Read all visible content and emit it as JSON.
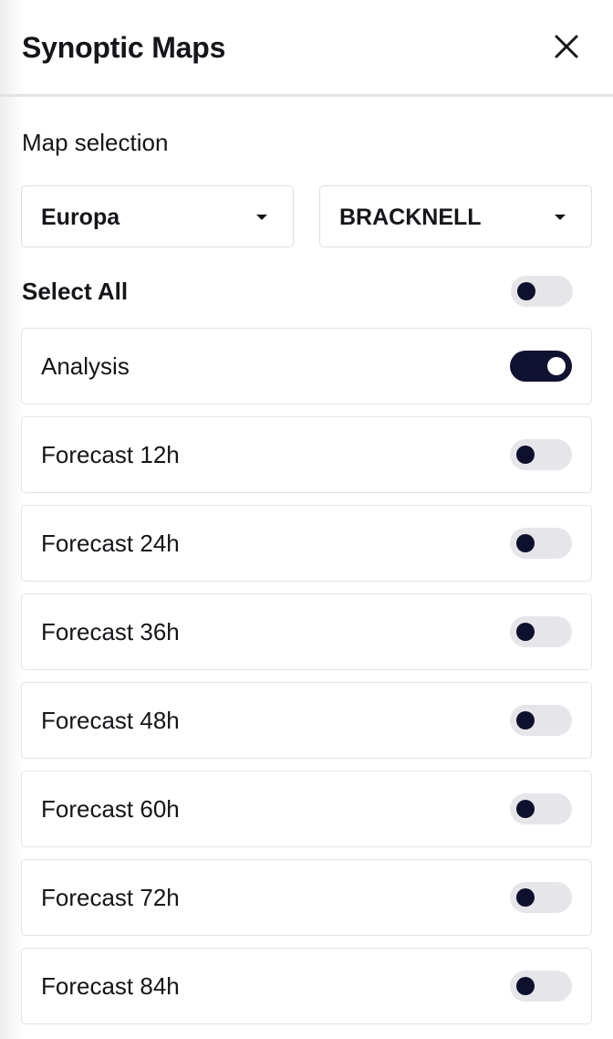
{
  "header": {
    "title": "Synoptic Maps",
    "close_icon": "close-icon"
  },
  "map_selection": {
    "label": "Map selection",
    "region": {
      "value": "Europa",
      "icon": "caret-down-icon"
    },
    "source": {
      "value": "BRACKNELL",
      "icon": "caret-down-icon"
    }
  },
  "select_all": {
    "label": "Select All",
    "checked": false
  },
  "items": [
    {
      "label": "Analysis",
      "checked": true
    },
    {
      "label": "Forecast 12h",
      "checked": false
    },
    {
      "label": "Forecast 24h",
      "checked": false
    },
    {
      "label": "Forecast 36h",
      "checked": false
    },
    {
      "label": "Forecast 48h",
      "checked": false
    },
    {
      "label": "Forecast 60h",
      "checked": false
    },
    {
      "label": "Forecast 72h",
      "checked": false
    },
    {
      "label": "Forecast 84h",
      "checked": false
    }
  ],
  "colors": {
    "toggle_on": "#111131",
    "toggle_off": "#e6e6ea",
    "knob_dark": "#0f0f2e",
    "border": "#e3e3e6"
  }
}
